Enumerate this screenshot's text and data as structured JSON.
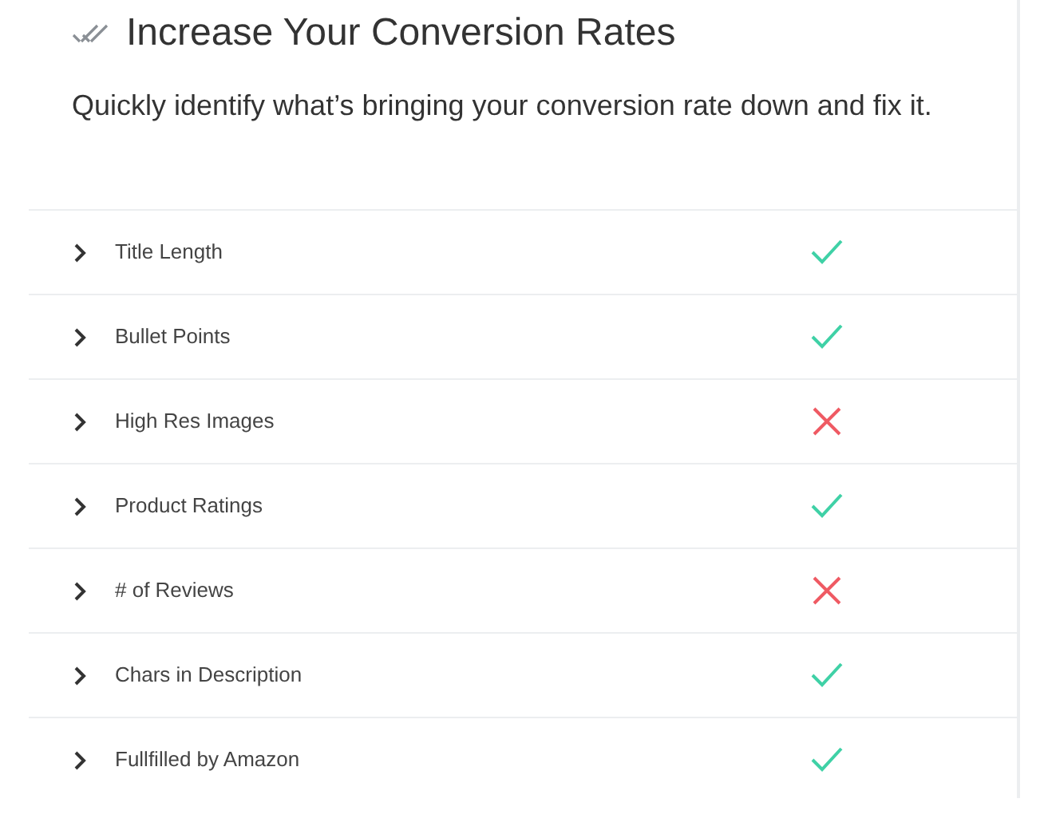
{
  "header": {
    "title": "Increase Your Conversion Rates",
    "subtitle": "Quickly identify what’s bringing your conversion rate down and fix it."
  },
  "rows": [
    {
      "label": "Title Length",
      "passed": true
    },
    {
      "label": "Bullet Points",
      "passed": true
    },
    {
      "label": "High Res Images",
      "passed": false
    },
    {
      "label": "Product Ratings",
      "passed": true
    },
    {
      "label": "# of Reviews",
      "passed": false
    },
    {
      "label": "Chars in Description",
      "passed": true
    },
    {
      "label": "Fullfilled by Amazon",
      "passed": true
    }
  ]
}
